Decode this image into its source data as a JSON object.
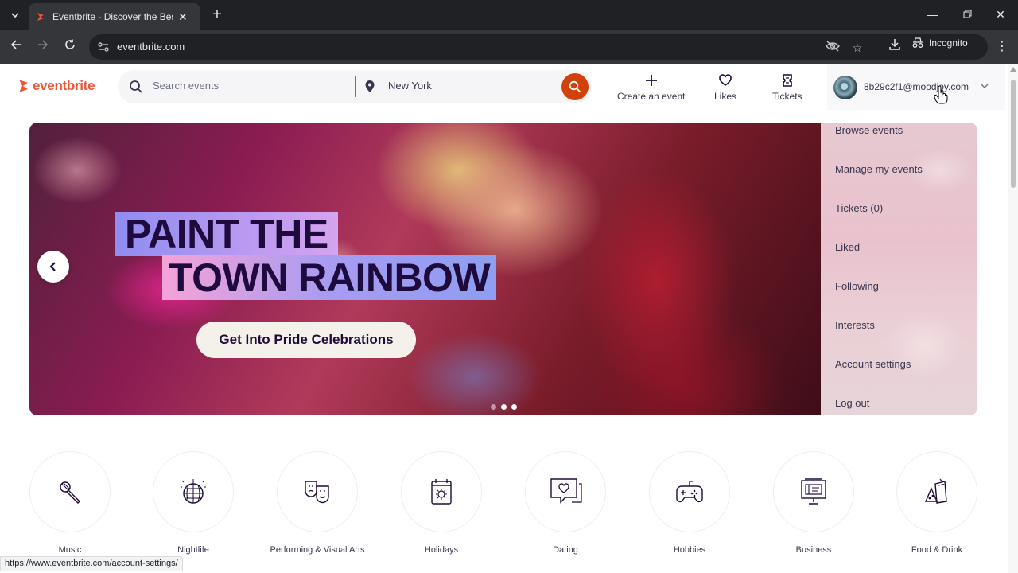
{
  "browser": {
    "tab_title": "Eventbrite - Discover the Best L",
    "url": "eventbrite.com",
    "incognito_label": "Incognito",
    "status_url": "https://www.eventbrite.com/account-settings/"
  },
  "header": {
    "logo_text": "eventbrite",
    "search_placeholder": "Search events",
    "location": "New York",
    "actions": [
      {
        "label": "Create an event",
        "icon": "plus-icon"
      },
      {
        "label": "Likes",
        "icon": "heart-icon"
      },
      {
        "label": "Tickets",
        "icon": "ticket-icon"
      }
    ],
    "account_email": "8b29c2f1@moodjoy.com"
  },
  "hero": {
    "headline_line1": "PAINT THE",
    "headline_line2": "TOWN RAINBOW",
    "cta_label": "Get Into Pride Celebrations",
    "slide_count": 3,
    "active_slide": 3
  },
  "dropdown": {
    "items": [
      "Browse events",
      "Manage my events",
      "Tickets (0)",
      "Liked",
      "Following",
      "Interests",
      "Account settings",
      "Log out"
    ]
  },
  "categories": [
    {
      "label": "Music",
      "icon": "microphone-icon"
    },
    {
      "label": "Nightlife",
      "icon": "disco-ball-icon"
    },
    {
      "label": "Performing & Visual Arts",
      "icon": "theater-masks-icon"
    },
    {
      "label": "Holidays",
      "icon": "calendar-sun-icon"
    },
    {
      "label": "Dating",
      "icon": "chat-heart-icon"
    },
    {
      "label": "Hobbies",
      "icon": "gamepad-icon"
    },
    {
      "label": "Business",
      "icon": "presentation-board-icon"
    },
    {
      "label": "Food & Drink",
      "icon": "food-drink-icon"
    }
  ],
  "colors": {
    "brand": "#f05537",
    "search_button": "#d1410c",
    "text": "#39364f"
  }
}
